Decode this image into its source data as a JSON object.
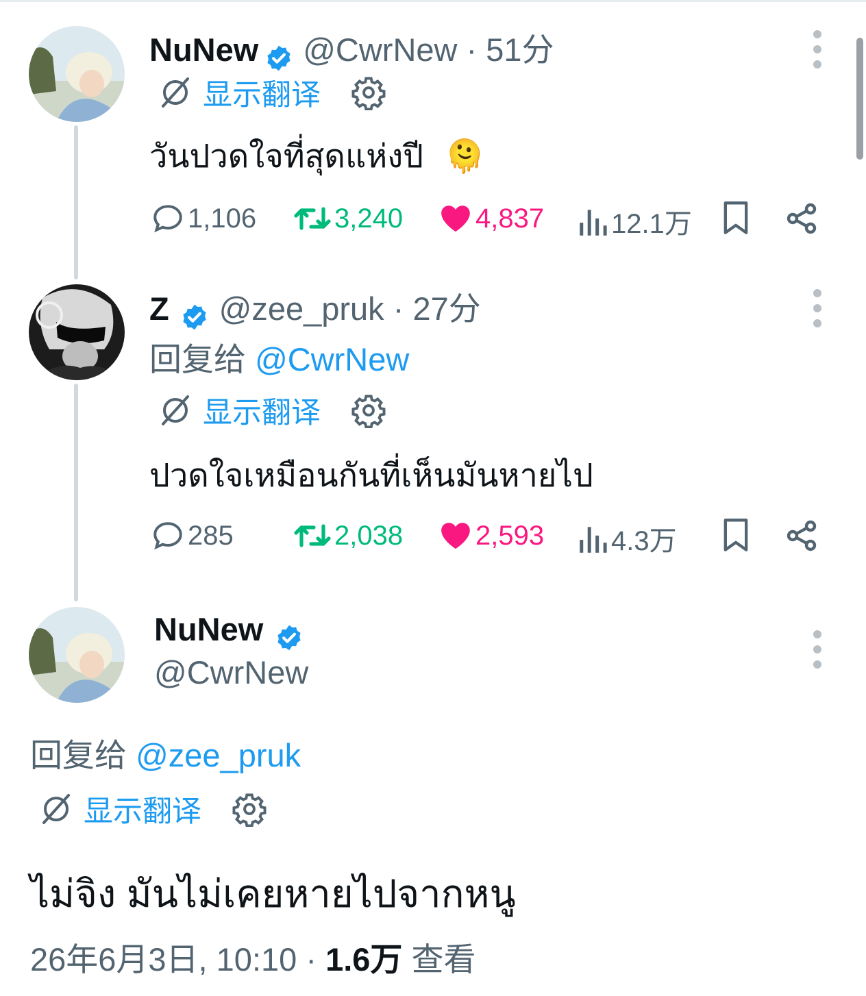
{
  "colors": {
    "accent": "#1d9bf0",
    "retweet": "#00ba7c",
    "like": "#f91880",
    "muted": "#536471",
    "text": "#0f1419"
  },
  "tweets": [
    {
      "name": "NuNew",
      "handle_time": "@CwrNew · 51分",
      "translate_label": "显示翻译",
      "text": "วันปวดใจที่สุดแห่งปี",
      "emoji": "🫠",
      "stats": {
        "replies": "1,106",
        "retweets": "3,240",
        "likes": "4,837",
        "views": "12.1万"
      }
    },
    {
      "name": "Z",
      "handle_time": "@zee_pruk · 27分",
      "reply_prefix": "回复给",
      "reply_mention": "@CwrNew",
      "translate_label": "显示翻译",
      "text": "ปวดใจเหมือนกันที่เห็นมันหายไป",
      "stats": {
        "replies": "285",
        "retweets": "2,038",
        "likes": "2,593",
        "views": "4.3万"
      }
    },
    {
      "name": "NuNew",
      "handle": "@CwrNew",
      "reply_prefix": "回复给",
      "reply_mention": "@zee_pruk",
      "translate_label": "显示翻译",
      "text": "ไม่จิง มันไม่เคยหายไปจากหนู",
      "timestamp": "26年6月3日, 10:10 · ",
      "views_count": "1.6万",
      "views_label": " 查看"
    }
  ]
}
